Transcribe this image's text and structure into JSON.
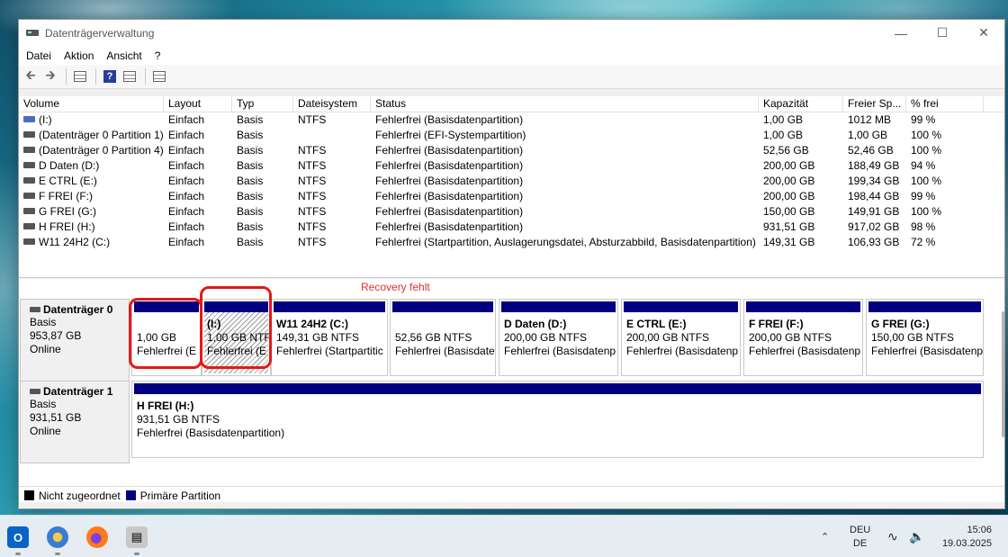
{
  "window": {
    "title": "Datenträgerverwaltung"
  },
  "menu": [
    "Datei",
    "Aktion",
    "Ansicht",
    "?"
  ],
  "table": {
    "headers": [
      "Volume",
      "Layout",
      "Typ",
      "Dateisystem",
      "Status",
      "Kapazität",
      "Freier Sp...",
      "% frei"
    ],
    "rows": [
      [
        "(I:)",
        "Einfach",
        "Basis",
        "NTFS",
        "Fehlerfrei (Basisdatenpartition)",
        "1,00 GB",
        "1012 MB",
        "99 %"
      ],
      [
        "(Datenträger 0 Partition 1)",
        "Einfach",
        "Basis",
        "",
        "Fehlerfrei (EFI-Systempartition)",
        "1,00 GB",
        "1,00 GB",
        "100 %"
      ],
      [
        "(Datenträger 0 Partition 4)",
        "Einfach",
        "Basis",
        "NTFS",
        "Fehlerfrei (Basisdatenpartition)",
        "52,56 GB",
        "52,46 GB",
        "100 %"
      ],
      [
        "D Daten (D:)",
        "Einfach",
        "Basis",
        "NTFS",
        "Fehlerfrei (Basisdatenpartition)",
        "200,00 GB",
        "188,49 GB",
        "94 %"
      ],
      [
        "E CTRL (E:)",
        "Einfach",
        "Basis",
        "NTFS",
        "Fehlerfrei (Basisdatenpartition)",
        "200,00 GB",
        "199,34 GB",
        "100 %"
      ],
      [
        "F FREI (F:)",
        "Einfach",
        "Basis",
        "NTFS",
        "Fehlerfrei (Basisdatenpartition)",
        "200,00 GB",
        "198,44 GB",
        "99 %"
      ],
      [
        "G FREI (G:)",
        "Einfach",
        "Basis",
        "NTFS",
        "Fehlerfrei (Basisdatenpartition)",
        "150,00 GB",
        "149,91 GB",
        "100 %"
      ],
      [
        "H FREI (H:)",
        "Einfach",
        "Basis",
        "NTFS",
        "Fehlerfrei (Basisdatenpartition)",
        "931,51 GB",
        "917,02 GB",
        "98 %"
      ],
      [
        "W11 24H2 (C:)",
        "Einfach",
        "Basis",
        "NTFS",
        "Fehlerfrei (Startpartition, Auslagerungsdatei, Absturzabbild, Basisdatenpartition)",
        "149,31 GB",
        "106,93 GB",
        "72 %"
      ]
    ]
  },
  "annotation": "Recovery fehlt",
  "disks": [
    {
      "name": "Datenträger 0",
      "type": "Basis",
      "size": "953,87 GB",
      "state": "Online",
      "partitions": [
        {
          "name": "",
          "size": "1,00 GB",
          "status": "Fehlerfrei (E"
        },
        {
          "name": "(I:)",
          "size": "1,00 GB NTF",
          "status": "Fehlerfrei (E"
        },
        {
          "name": "W11 24H2  (C:)",
          "size": "149,31 GB NTFS",
          "status": "Fehlerfrei (Startpartitic"
        },
        {
          "name": "",
          "size": "52,56 GB NTFS",
          "status": "Fehlerfrei (Basisdate"
        },
        {
          "name": "D Daten  (D:)",
          "size": "200,00 GB NTFS",
          "status": "Fehlerfrei (Basisdatenp"
        },
        {
          "name": "E CTRL  (E:)",
          "size": "200,00 GB NTFS",
          "status": "Fehlerfrei (Basisdatenp"
        },
        {
          "name": "F FREI  (F:)",
          "size": "200,00 GB NTFS",
          "status": "Fehlerfrei (Basisdatenp"
        },
        {
          "name": "G FREI  (G:)",
          "size": "150,00 GB NTFS",
          "status": "Fehlerfrei (Basisdatenp"
        }
      ]
    },
    {
      "name": "Datenträger 1",
      "type": "Basis",
      "size": "931,51 GB",
      "state": "Online",
      "partitions": [
        {
          "name": "H FREI  (H:)",
          "size": "931,51 GB NTFS",
          "status": "Fehlerfrei (Basisdatenpartition)"
        }
      ]
    }
  ],
  "legend": {
    "unallocated": "Nicht zugeordnet",
    "primary": "Primäre Partition"
  },
  "colors": {
    "primary_partition": "#000080",
    "unallocated": "#000000",
    "highlight": "#e21a1a"
  },
  "taskbar": {
    "apps": [
      "outlook-icon",
      "browser-icon",
      "firefox-icon",
      "disk-management-icon"
    ],
    "lang1": "DEU",
    "lang2": "DE",
    "time": "15:06",
    "date": "19.03.2025"
  }
}
